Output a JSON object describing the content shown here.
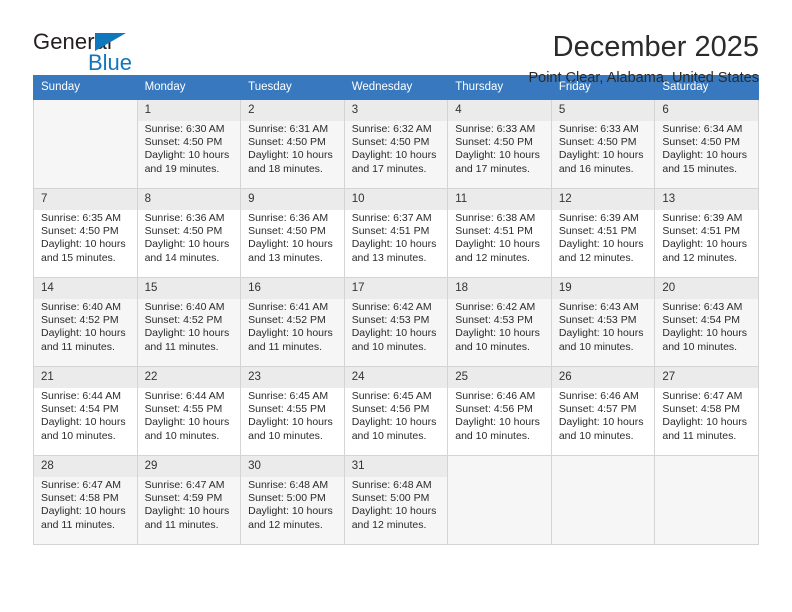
{
  "logo": {
    "word_one": "General",
    "word_two": "Blue",
    "triangle_icon": "blue-triangle-icon",
    "brand_color": "#1077bc"
  },
  "header": {
    "month_title": "December 2025",
    "location": "Point Clear, Alabama, United States"
  },
  "theme": {
    "header_blue": "#3778be",
    "daynum_band": "#ebebeb",
    "alt_row": "#f6f6f6",
    "grid_border": "#d4d4d4"
  },
  "calendar": {
    "weekday_headers": [
      "Sunday",
      "Monday",
      "Tuesday",
      "Wednesday",
      "Thursday",
      "Friday",
      "Saturday"
    ],
    "weeks": [
      [
        {
          "day": "",
          "sunrise": "",
          "sunset": "",
          "daylight_line1": "",
          "daylight_line2": ""
        },
        {
          "day": "1",
          "sunrise": "Sunrise: 6:30 AM",
          "sunset": "Sunset: 4:50 PM",
          "daylight_line1": "Daylight: 10 hours",
          "daylight_line2": "and 19 minutes."
        },
        {
          "day": "2",
          "sunrise": "Sunrise: 6:31 AM",
          "sunset": "Sunset: 4:50 PM",
          "daylight_line1": "Daylight: 10 hours",
          "daylight_line2": "and 18 minutes."
        },
        {
          "day": "3",
          "sunrise": "Sunrise: 6:32 AM",
          "sunset": "Sunset: 4:50 PM",
          "daylight_line1": "Daylight: 10 hours",
          "daylight_line2": "and 17 minutes."
        },
        {
          "day": "4",
          "sunrise": "Sunrise: 6:33 AM",
          "sunset": "Sunset: 4:50 PM",
          "daylight_line1": "Daylight: 10 hours",
          "daylight_line2": "and 17 minutes."
        },
        {
          "day": "5",
          "sunrise": "Sunrise: 6:33 AM",
          "sunset": "Sunset: 4:50 PM",
          "daylight_line1": "Daylight: 10 hours",
          "daylight_line2": "and 16 minutes."
        },
        {
          "day": "6",
          "sunrise": "Sunrise: 6:34 AM",
          "sunset": "Sunset: 4:50 PM",
          "daylight_line1": "Daylight: 10 hours",
          "daylight_line2": "and 15 minutes."
        }
      ],
      [
        {
          "day": "7",
          "sunrise": "Sunrise: 6:35 AM",
          "sunset": "Sunset: 4:50 PM",
          "daylight_line1": "Daylight: 10 hours",
          "daylight_line2": "and 15 minutes."
        },
        {
          "day": "8",
          "sunrise": "Sunrise: 6:36 AM",
          "sunset": "Sunset: 4:50 PM",
          "daylight_line1": "Daylight: 10 hours",
          "daylight_line2": "and 14 minutes."
        },
        {
          "day": "9",
          "sunrise": "Sunrise: 6:36 AM",
          "sunset": "Sunset: 4:50 PM",
          "daylight_line1": "Daylight: 10 hours",
          "daylight_line2": "and 13 minutes."
        },
        {
          "day": "10",
          "sunrise": "Sunrise: 6:37 AM",
          "sunset": "Sunset: 4:51 PM",
          "daylight_line1": "Daylight: 10 hours",
          "daylight_line2": "and 13 minutes."
        },
        {
          "day": "11",
          "sunrise": "Sunrise: 6:38 AM",
          "sunset": "Sunset: 4:51 PM",
          "daylight_line1": "Daylight: 10 hours",
          "daylight_line2": "and 12 minutes."
        },
        {
          "day": "12",
          "sunrise": "Sunrise: 6:39 AM",
          "sunset": "Sunset: 4:51 PM",
          "daylight_line1": "Daylight: 10 hours",
          "daylight_line2": "and 12 minutes."
        },
        {
          "day": "13",
          "sunrise": "Sunrise: 6:39 AM",
          "sunset": "Sunset: 4:51 PM",
          "daylight_line1": "Daylight: 10 hours",
          "daylight_line2": "and 12 minutes."
        }
      ],
      [
        {
          "day": "14",
          "sunrise": "Sunrise: 6:40 AM",
          "sunset": "Sunset: 4:52 PM",
          "daylight_line1": "Daylight: 10 hours",
          "daylight_line2": "and 11 minutes."
        },
        {
          "day": "15",
          "sunrise": "Sunrise: 6:40 AM",
          "sunset": "Sunset: 4:52 PM",
          "daylight_line1": "Daylight: 10 hours",
          "daylight_line2": "and 11 minutes."
        },
        {
          "day": "16",
          "sunrise": "Sunrise: 6:41 AM",
          "sunset": "Sunset: 4:52 PM",
          "daylight_line1": "Daylight: 10 hours",
          "daylight_line2": "and 11 minutes."
        },
        {
          "day": "17",
          "sunrise": "Sunrise: 6:42 AM",
          "sunset": "Sunset: 4:53 PM",
          "daylight_line1": "Daylight: 10 hours",
          "daylight_line2": "and 10 minutes."
        },
        {
          "day": "18",
          "sunrise": "Sunrise: 6:42 AM",
          "sunset": "Sunset: 4:53 PM",
          "daylight_line1": "Daylight: 10 hours",
          "daylight_line2": "and 10 minutes."
        },
        {
          "day": "19",
          "sunrise": "Sunrise: 6:43 AM",
          "sunset": "Sunset: 4:53 PM",
          "daylight_line1": "Daylight: 10 hours",
          "daylight_line2": "and 10 minutes."
        },
        {
          "day": "20",
          "sunrise": "Sunrise: 6:43 AM",
          "sunset": "Sunset: 4:54 PM",
          "daylight_line1": "Daylight: 10 hours",
          "daylight_line2": "and 10 minutes."
        }
      ],
      [
        {
          "day": "21",
          "sunrise": "Sunrise: 6:44 AM",
          "sunset": "Sunset: 4:54 PM",
          "daylight_line1": "Daylight: 10 hours",
          "daylight_line2": "and 10 minutes."
        },
        {
          "day": "22",
          "sunrise": "Sunrise: 6:44 AM",
          "sunset": "Sunset: 4:55 PM",
          "daylight_line1": "Daylight: 10 hours",
          "daylight_line2": "and 10 minutes."
        },
        {
          "day": "23",
          "sunrise": "Sunrise: 6:45 AM",
          "sunset": "Sunset: 4:55 PM",
          "daylight_line1": "Daylight: 10 hours",
          "daylight_line2": "and 10 minutes."
        },
        {
          "day": "24",
          "sunrise": "Sunrise: 6:45 AM",
          "sunset": "Sunset: 4:56 PM",
          "daylight_line1": "Daylight: 10 hours",
          "daylight_line2": "and 10 minutes."
        },
        {
          "day": "25",
          "sunrise": "Sunrise: 6:46 AM",
          "sunset": "Sunset: 4:56 PM",
          "daylight_line1": "Daylight: 10 hours",
          "daylight_line2": "and 10 minutes."
        },
        {
          "day": "26",
          "sunrise": "Sunrise: 6:46 AM",
          "sunset": "Sunset: 4:57 PM",
          "daylight_line1": "Daylight: 10 hours",
          "daylight_line2": "and 10 minutes."
        },
        {
          "day": "27",
          "sunrise": "Sunrise: 6:47 AM",
          "sunset": "Sunset: 4:58 PM",
          "daylight_line1": "Daylight: 10 hours",
          "daylight_line2": "and 11 minutes."
        }
      ],
      [
        {
          "day": "28",
          "sunrise": "Sunrise: 6:47 AM",
          "sunset": "Sunset: 4:58 PM",
          "daylight_line1": "Daylight: 10 hours",
          "daylight_line2": "and 11 minutes."
        },
        {
          "day": "29",
          "sunrise": "Sunrise: 6:47 AM",
          "sunset": "Sunset: 4:59 PM",
          "daylight_line1": "Daylight: 10 hours",
          "daylight_line2": "and 11 minutes."
        },
        {
          "day": "30",
          "sunrise": "Sunrise: 6:48 AM",
          "sunset": "Sunset: 5:00 PM",
          "daylight_line1": "Daylight: 10 hours",
          "daylight_line2": "and 12 minutes."
        },
        {
          "day": "31",
          "sunrise": "Sunrise: 6:48 AM",
          "sunset": "Sunset: 5:00 PM",
          "daylight_line1": "Daylight: 10 hours",
          "daylight_line2": "and 12 minutes."
        },
        {
          "day": "",
          "sunrise": "",
          "sunset": "",
          "daylight_line1": "",
          "daylight_line2": ""
        },
        {
          "day": "",
          "sunrise": "",
          "sunset": "",
          "daylight_line1": "",
          "daylight_line2": ""
        },
        {
          "day": "",
          "sunrise": "",
          "sunset": "",
          "daylight_line1": "",
          "daylight_line2": ""
        }
      ]
    ]
  }
}
